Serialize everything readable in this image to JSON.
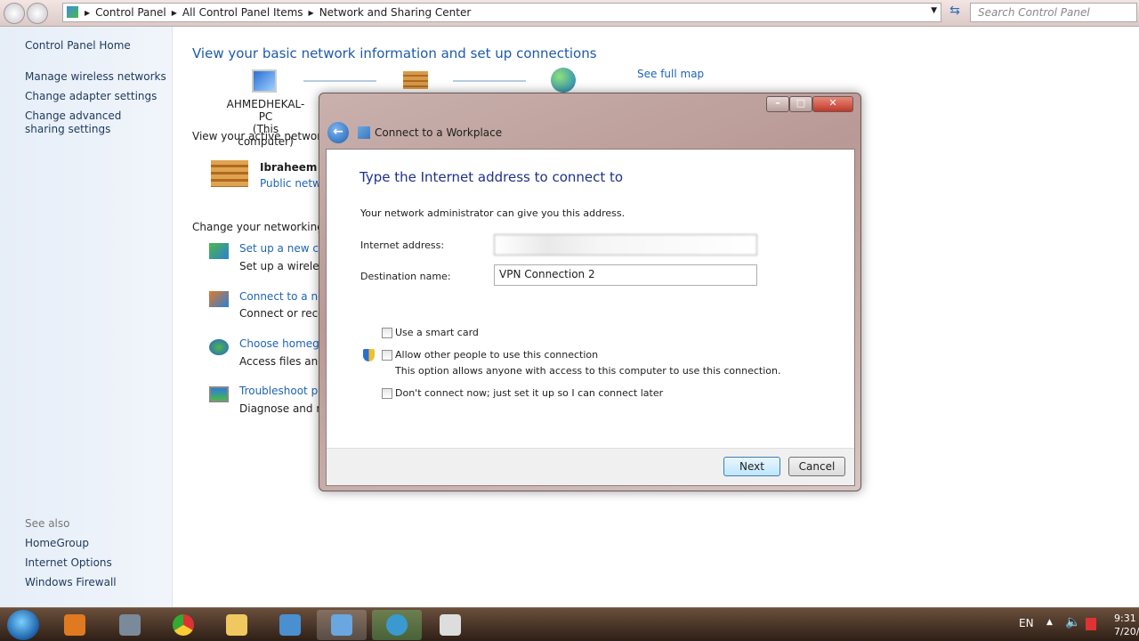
{
  "address_bar": {
    "crumbs": [
      "Control Panel",
      "All Control Panel Items",
      "Network and Sharing Center"
    ],
    "search_placeholder": "Search Control Panel"
  },
  "sidebar": {
    "home": "Control Panel Home",
    "links": [
      "Manage wireless networks",
      "Change adapter settings",
      "Change advanced sharing settings"
    ],
    "see_also_label": "See also",
    "see_also": [
      "HomeGroup",
      "Internet Options",
      "Windows Firewall"
    ]
  },
  "main": {
    "title": "View your basic network information and set up connections",
    "computer_name": "AHMEDHEKAL-PC",
    "computer_sub": "(This computer)",
    "see_full_map": "See full map",
    "active_networks_label": "View your active networks",
    "network_name": "Ibraheem",
    "network_type": "Public netwo",
    "change_settings_label": "Change your networking se",
    "tasks": [
      {
        "title": "Set up a new con",
        "desc": "Set up a wireless,"
      },
      {
        "title": "Connect to a netv",
        "desc": "Connect or recon"
      },
      {
        "title": "Choose homegro",
        "desc": "Access files and p"
      },
      {
        "title": "Troubleshoot pro",
        "desc": "Diagnose and rep"
      }
    ]
  },
  "dialog": {
    "title": "Connect to a Workplace",
    "heading": "Type the Internet address to connect to",
    "info": "Your network administrator can give you this address.",
    "internet_address_label": "Internet address:",
    "internet_address_value": "",
    "destination_label": "Destination name:",
    "destination_value": "VPN Connection 2",
    "options": [
      {
        "label": "Use a smart card",
        "checked": false
      },
      {
        "label": "Allow other people to use this connection",
        "checked": false,
        "desc": "This option allows anyone with access to this computer to use this connection."
      },
      {
        "label": "Don't connect now; just set it up so I can connect later",
        "checked": false
      }
    ],
    "next": "Next",
    "cancel": "Cancel"
  },
  "taskbar": {
    "language": "EN",
    "time": "9:31",
    "date": "7/20/"
  }
}
